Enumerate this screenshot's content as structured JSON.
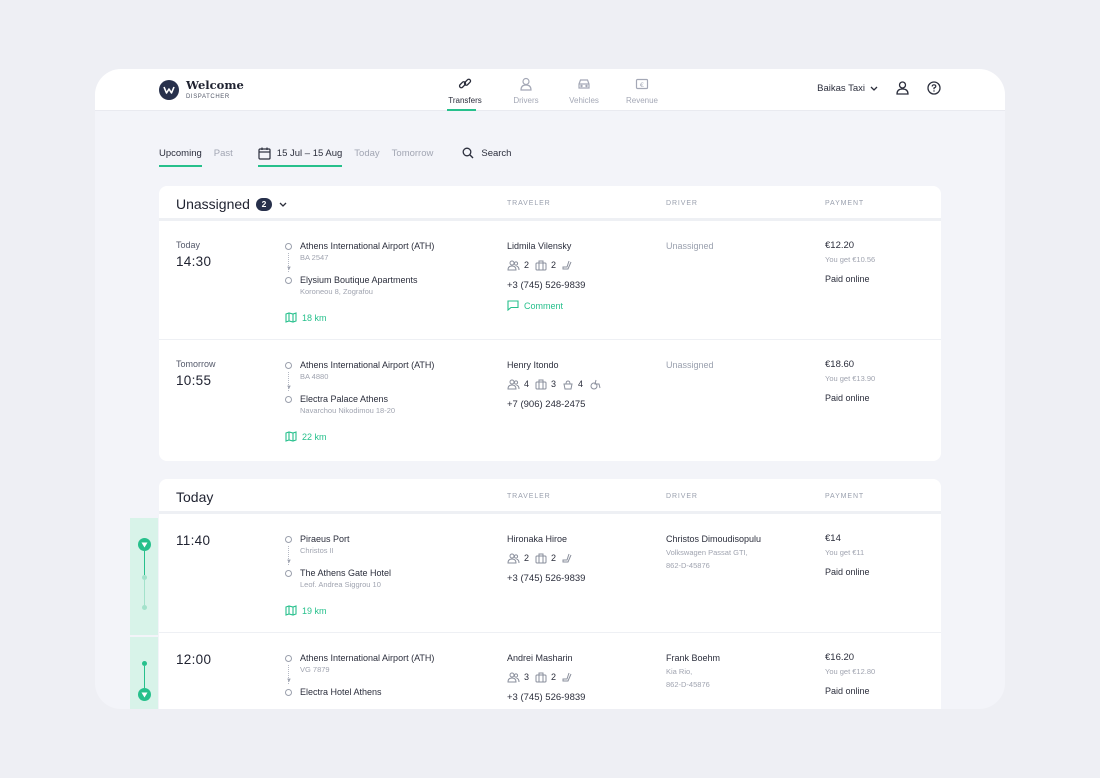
{
  "brand": {
    "title": "Welcome",
    "subtitle": "DISPATCHER"
  },
  "nav": [
    {
      "label": "Transfers",
      "icon": "transfers-icon",
      "active": true
    },
    {
      "label": "Drivers",
      "icon": "drivers-icon",
      "active": false
    },
    {
      "label": "Vehicles",
      "icon": "vehicles-icon",
      "active": false
    },
    {
      "label": "Revenue",
      "icon": "revenue-icon",
      "active": false
    }
  ],
  "company": "Baikas Taxi",
  "filters": {
    "upcoming": "Upcoming",
    "past": "Past",
    "date_range": "15 Jul  – 15 Aug",
    "today": "Today",
    "tomorrow": "Tomorrow",
    "search": "Search"
  },
  "columns": {
    "traveler": "TRAVELER",
    "driver": "DRIVER",
    "payment": "PAYMENT"
  },
  "colors": {
    "accent": "#27c08c",
    "dark": "#27304b"
  },
  "unassigned": {
    "title": "Unassigned",
    "count": "2",
    "rows": [
      {
        "day": "Today",
        "time": "14:30",
        "from": "Athens International Airport (ATH)",
        "from_sub": "BA 2547",
        "to": "Elysium Boutique Apartments",
        "to_sub": "Koroneou 8, Zografou",
        "distance": "18 km",
        "traveler": "Lidmila Vilensky",
        "passengers": "2",
        "bags": "2",
        "phone": "+3 (745) 526-9839",
        "comment": "Comment",
        "driver": "Unassigned",
        "price": "€12.20",
        "you_get": "You get €10.56",
        "payment": "Paid online"
      },
      {
        "day": "Tomorrow",
        "time": "10:55",
        "from": "Athens International Airport (ATH)",
        "from_sub": "BA 4880",
        "to": "Electra Palace Athens",
        "to_sub": "Navarchou Nikodimou 18-20",
        "distance": "22 km",
        "traveler": "Henry Itondo",
        "passengers": "4",
        "bags": "3",
        "child_seats": "4",
        "phone": "+7 (906) 248-2475",
        "driver": "Unassigned",
        "price": "€18.60",
        "you_get": "You get €13.90",
        "payment": "Paid online"
      }
    ]
  },
  "today": {
    "title": "Today",
    "rows": [
      {
        "time": "11:40",
        "from": "Piraeus Port",
        "from_sub": "Christos II",
        "to": "The Athens Gate Hotel",
        "to_sub": "Leof. Andrea Siggrou 10",
        "distance": "19 km",
        "traveler": "Hironaka Hiroe",
        "passengers": "2",
        "bags": "2",
        "phone": "+3 (745) 526-9839",
        "driver": "Christos Dimoudisopulu",
        "vehicle": "Volkswagen Passat GTI,",
        "plate": "862-D-45876",
        "price": "€14",
        "you_get": "You get €11",
        "payment": "Paid online"
      },
      {
        "time": "12:00",
        "from": "Athens International Airport (ATH)",
        "from_sub": "VG 7879",
        "to": "Electra Hotel Athens",
        "traveler": "Andrei Masharin",
        "passengers": "3",
        "bags": "2",
        "phone": "+3 (745) 526-9839",
        "driver": "Frank Boehm",
        "vehicle": "Kia Rio,",
        "plate": "862-D-45876",
        "price": "€16.20",
        "you_get": "You get €12.80",
        "payment": "Paid online"
      }
    ]
  }
}
